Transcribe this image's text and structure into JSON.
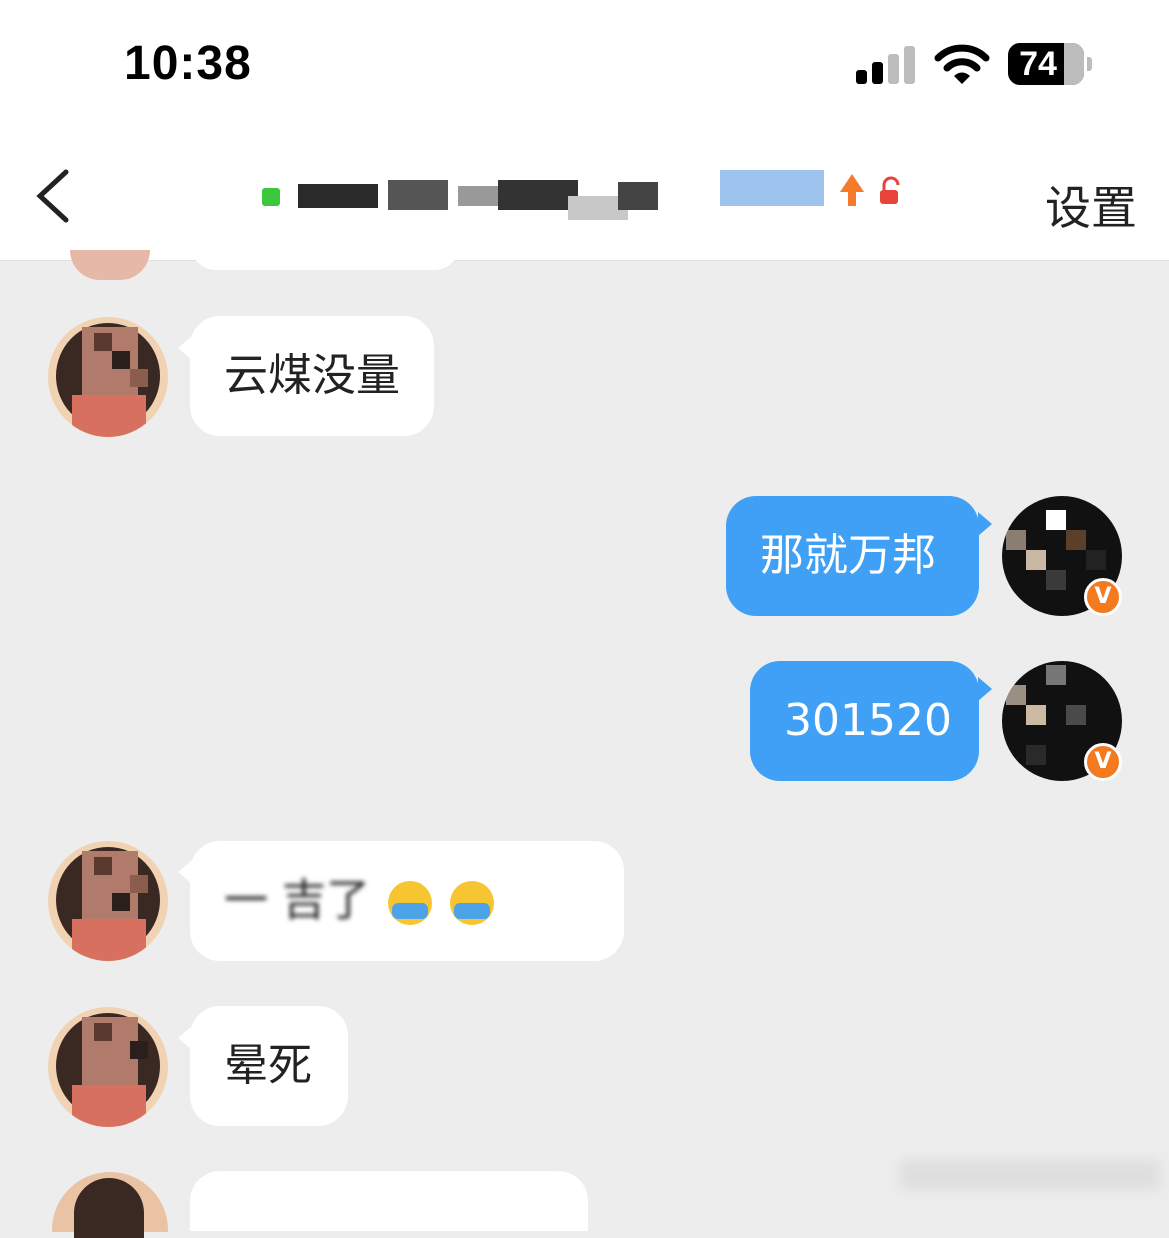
{
  "status_bar": {
    "time": "10:38",
    "battery": "74",
    "signal_icon": "cellular-signal-icon",
    "wifi_icon": "wifi-icon"
  },
  "nav": {
    "back_icon": "chevron-left-icon",
    "settings_label": "设置",
    "online_color": "#3cc83c"
  },
  "messages": [
    {
      "side": "left",
      "text": "云煤没量"
    },
    {
      "side": "right",
      "text": "那就万邦"
    },
    {
      "side": "right",
      "text": "301520"
    },
    {
      "side": "left",
      "text": "一 吉了"
    },
    {
      "side": "left",
      "text": "晕死"
    }
  ],
  "colors": {
    "background": "#ededed",
    "bubble_sent": "#3fa0f5",
    "bubble_received": "#ffffff",
    "verified_badge": "#f47a1f"
  }
}
